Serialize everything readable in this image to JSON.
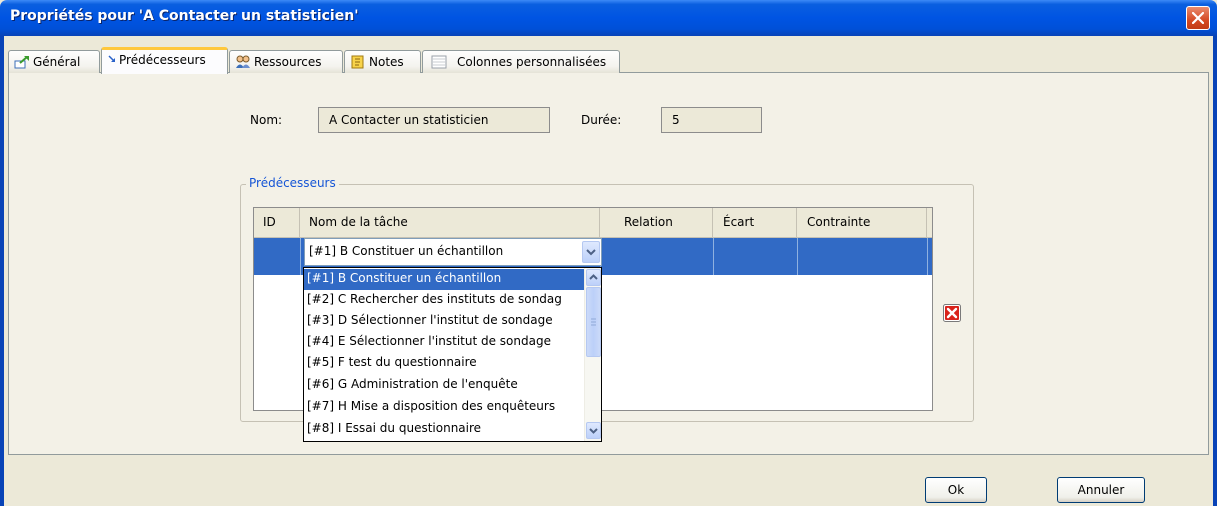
{
  "window": {
    "title": "Propriétés pour 'A Contacter un statisticien'"
  },
  "tabs": [
    {
      "label": "Général",
      "icon": "task-general-icon"
    },
    {
      "label": "Prédécesseurs",
      "icon": "predecessor-arrow-icon"
    },
    {
      "label": "Ressources",
      "icon": "people-icon"
    },
    {
      "label": "Notes",
      "icon": "notes-icon"
    },
    {
      "label": "Colonnes personnalisées",
      "icon": "table-columns-icon"
    }
  ],
  "active_tab": "Prédécesseurs",
  "task": {
    "name_label": "Nom:",
    "name_value": "A Contacter un statisticien",
    "duration_label": "Durée:",
    "duration_value": "5"
  },
  "predecessors": {
    "group_title": "Prédécesseurs",
    "columns": [
      "ID",
      "Nom de la tâche",
      "Relation",
      "Écart",
      "Contrainte"
    ],
    "selected_value": "[#1] B Constituer un échantillon",
    "options": [
      "[#1] B Constituer un échantillon",
      "[#2] C Rechercher des instituts de sondag",
      "[#3] D Sélectionner l'institut de sondage",
      "[#4] E Sélectionner l'institut de sondage",
      "[#5] F test du questionnaire",
      "[#6] G Administration de l'enquête",
      "[#7] H Mise a disposition des enquêteurs",
      "[#8] I Essai du questionnaire"
    ]
  },
  "buttons": {
    "ok": "Ok",
    "cancel": "Annuler"
  },
  "colors": {
    "titlebar": "#0054e3",
    "selection": "#316ac5",
    "tab_highlight": "#ffc83c",
    "group_title": "#1555d6"
  }
}
